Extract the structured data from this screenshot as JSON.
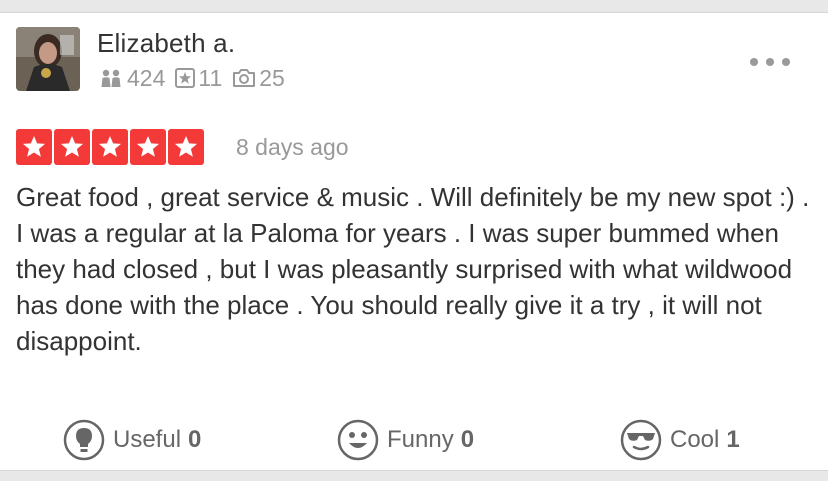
{
  "review": {
    "user": {
      "name": "Elizabeth a.",
      "friends": "424",
      "reviews": "11",
      "photos": "25",
      "avatar": "avatar-image"
    },
    "rating": 5,
    "date": "8 days ago",
    "text": "Great food , great service & music . Will definitely be my new spot :) . I was a regular at la Paloma for years . I was super bummed when they had closed , but I was pleasantly surprised with what wildwood has done with the place . You should really give it a try , it will not disappoint.",
    "votes": {
      "useful": {
        "label": "Useful",
        "count": "0"
      },
      "funny": {
        "label": "Funny",
        "count": "0"
      },
      "cool": {
        "label": "Cool",
        "count": "1"
      }
    }
  },
  "colors": {
    "star": "#f43939",
    "text": "#333333",
    "muted": "#999999"
  },
  "icons": [
    "friends-icon",
    "star-review-icon",
    "camera-icon",
    "more-icon",
    "useful-icon",
    "funny-icon",
    "cool-icon"
  ]
}
